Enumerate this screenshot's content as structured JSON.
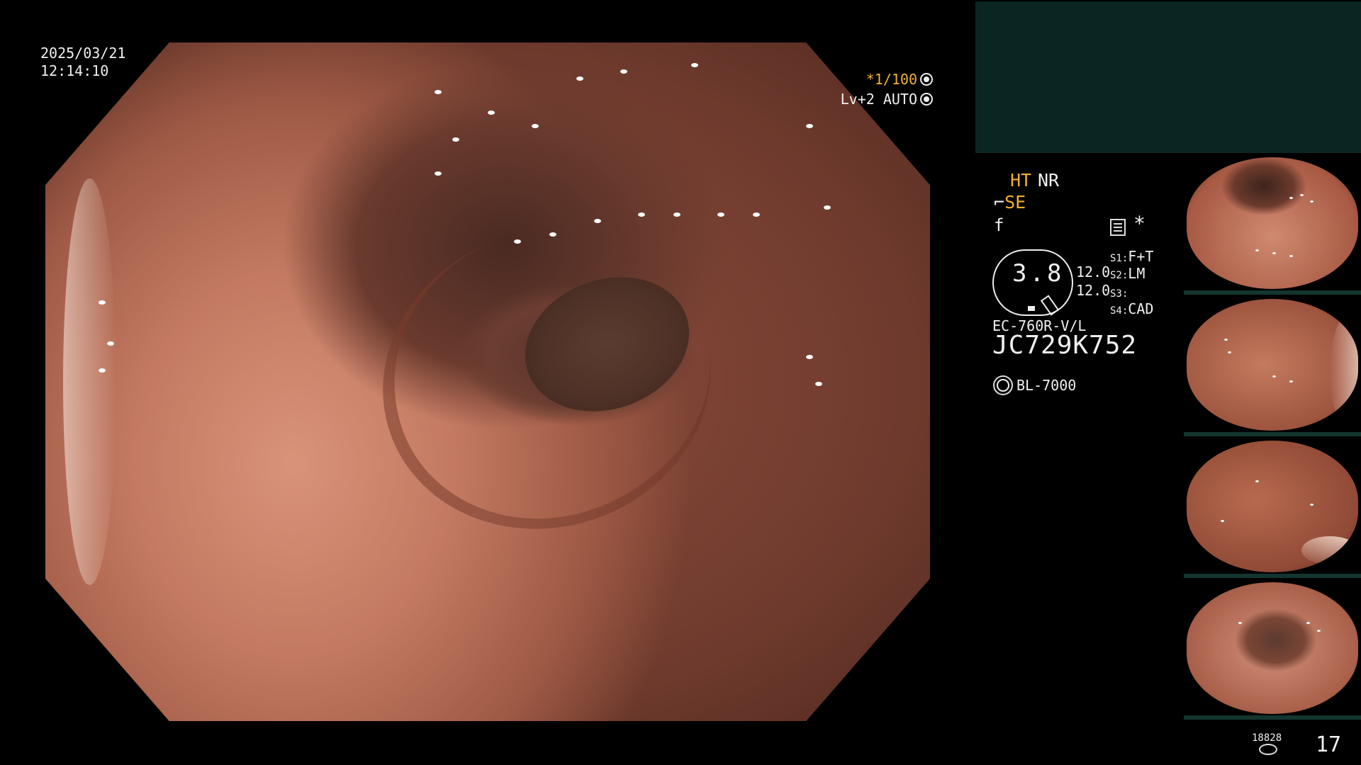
{
  "overlay": {
    "date": "2025/03/21",
    "time": "12:14:10",
    "shutter": "*1/100",
    "level": "Lv+2 AUTO"
  },
  "panel": {
    "ht": "HT",
    "nr": "NR",
    "se": "SE",
    "f_mark": "f",
    "star": "*",
    "zoom": "3.8",
    "value_1": "12.0",
    "value_2": "12.0",
    "s1_key": "S1:",
    "s1_val": "F+T",
    "s2_key": "S2:",
    "s2_val": "LM",
    "s3_key": "S3:",
    "s3_val": "",
    "s4_key": "S4:",
    "s4_val": "CAD",
    "scope_model": "EC-760R-V/L",
    "scope_serial": "JC729K752",
    "light_source": "BL-7000"
  },
  "storage": {
    "count": "18828",
    "page": "17"
  },
  "colors": {
    "accent_orange": "#f0b030",
    "panel_teal": "#0b2622"
  }
}
